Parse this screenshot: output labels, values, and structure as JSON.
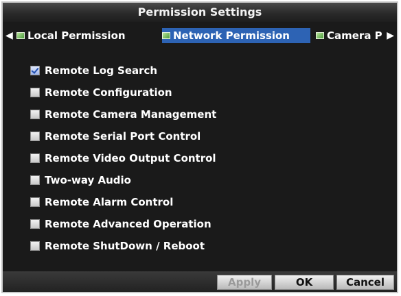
{
  "dialog": {
    "title": "Permission Settings"
  },
  "tabs": [
    {
      "label": "Local Permission",
      "active": false,
      "icon": "tab-icon"
    },
    {
      "label": "Network Permission",
      "active": true,
      "icon": "tab-icon"
    },
    {
      "label": "Camera P",
      "active": false,
      "icon": "tab-icon"
    }
  ],
  "permissions": [
    {
      "label": "Remote Log Search",
      "checked": true
    },
    {
      "label": "Remote Configuration",
      "checked": false
    },
    {
      "label": "Remote Camera Management",
      "checked": false
    },
    {
      "label": "Remote Serial Port Control",
      "checked": false
    },
    {
      "label": "Remote Video Output Control",
      "checked": false
    },
    {
      "label": "Two-way Audio",
      "checked": false
    },
    {
      "label": "Remote Alarm Control",
      "checked": false
    },
    {
      "label": "Remote Advanced Operation",
      "checked": false
    },
    {
      "label": "Remote ShutDown / Reboot",
      "checked": false
    }
  ],
  "buttons": {
    "apply": {
      "label": "Apply",
      "enabled": false
    },
    "ok": {
      "label": "OK",
      "enabled": true
    },
    "cancel": {
      "label": "Cancel",
      "enabled": true
    }
  },
  "colors": {
    "active_tab": "#2d63b4",
    "background": "#1a1a1a",
    "check": "#1f4fb0"
  }
}
